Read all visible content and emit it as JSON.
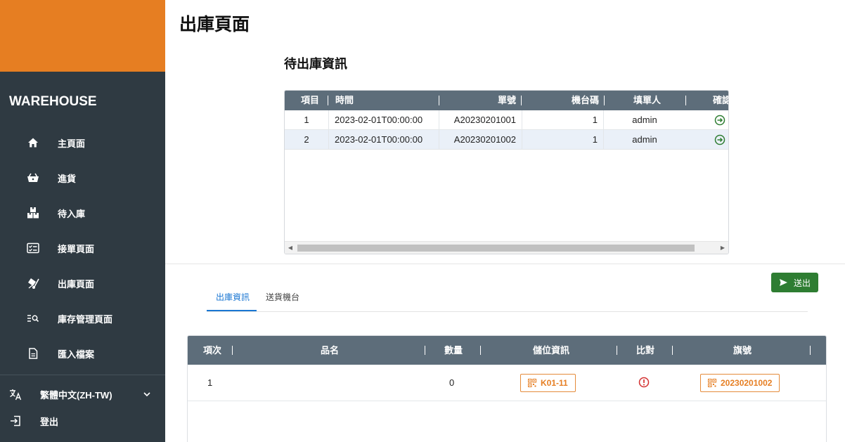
{
  "page_title": "出庫頁面",
  "sidebar": {
    "brand": "WAREHOUSE",
    "items": [
      {
        "label": "主頁面",
        "icon": "home-icon"
      },
      {
        "label": "進貨",
        "icon": "basket-icon"
      },
      {
        "label": "待入庫",
        "icon": "boxes-icon"
      },
      {
        "label": "接單頁面",
        "icon": "checklist-icon"
      },
      {
        "label": "出庫頁面",
        "icon": "dolly-icon"
      },
      {
        "label": "庫存管理頁面",
        "icon": "list-search-icon"
      },
      {
        "label": "匯入檔案",
        "icon": "file-icon"
      }
    ],
    "language": "繁體中文(ZH-TW)",
    "logout": "登出"
  },
  "pending": {
    "title": "待出庫資訊",
    "columns": [
      "項目",
      "時間",
      "單號",
      "機台碼",
      "填單人",
      "確認"
    ],
    "rows": [
      {
        "index": "1",
        "time": "2023-02-01T00:00:00",
        "order_no": "A20230201001",
        "machine": "1",
        "creator": "admin"
      },
      {
        "index": "2",
        "time": "2023-02-01T00:00:00",
        "order_no": "A20230201002",
        "machine": "1",
        "creator": "admin"
      }
    ]
  },
  "send_button": "送出",
  "tabs": [
    "出庫資訊",
    "送貨機台"
  ],
  "detail": {
    "columns": [
      "項次",
      "品名",
      "數量",
      "儲位資訊",
      "比對",
      "旗號"
    ],
    "rows": [
      {
        "index": "1",
        "name": "",
        "qty": "0",
        "location": "K01-11",
        "flag": "20230201002"
      }
    ]
  },
  "colors": {
    "sidebar": "#2f3a42",
    "brand_block": "#e67e22",
    "table_header": "#5d6d7a",
    "primary": "#1976d2",
    "success": "#2e7d32",
    "warning": "#d32f2f",
    "accent": "#e67e22"
  }
}
